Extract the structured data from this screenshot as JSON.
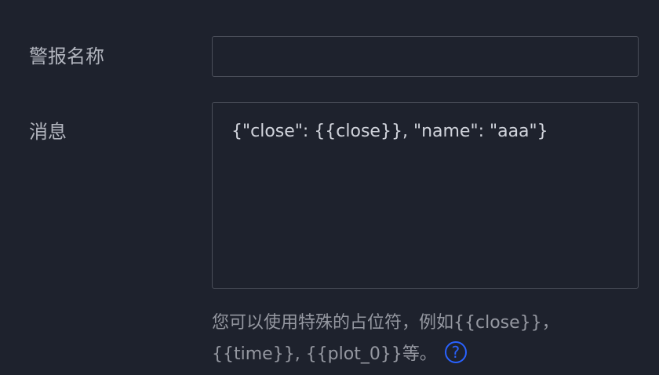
{
  "form": {
    "alert_name": {
      "label": "警报名称",
      "value": ""
    },
    "message": {
      "label": "消息",
      "value": "{\"close\": {{close}}, \"name\": \"aaa\"}"
    },
    "hint": {
      "text": "您可以使用特殊的占位符，例如{{close}}，{{time}}, {{plot_0}}等。",
      "help_glyph": "?",
      "help_icon": "question-circle-icon"
    }
  },
  "colors": {
    "background": "#1e222d",
    "border": "#4a4e59",
    "label": "#b2b5be",
    "hint": "#9598a1",
    "accent": "#2962ff"
  }
}
